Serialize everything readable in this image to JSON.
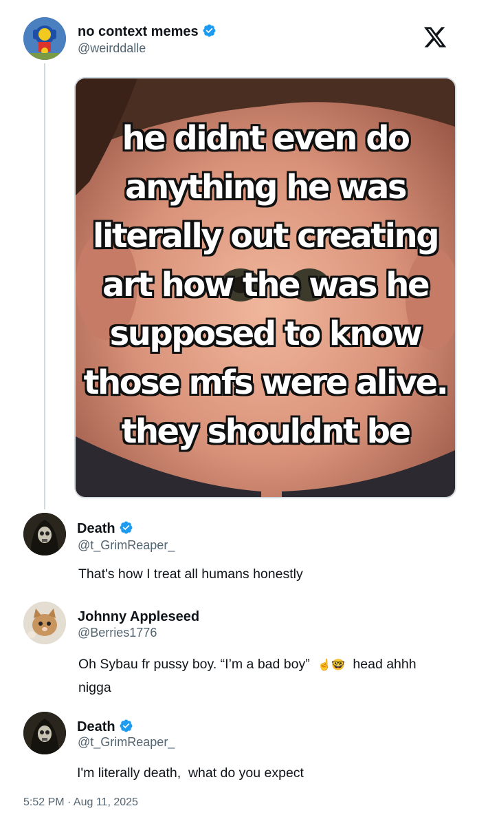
{
  "tweet": {
    "author_name": "no context memes",
    "author_handle": "@weirddalle",
    "meme_lines": [
      "he didnt even do",
      "anything he was",
      "literally out creating",
      "art how the was he",
      "supposed to know",
      "those mfs were alive.",
      "they shouldnt be"
    ],
    "timestamp": "5:52 PM · Aug 11, 2025"
  },
  "replies": [
    {
      "name": "Death",
      "handle": "@t_GrimReaper_",
      "text": "That's how I treat all humans honestly"
    },
    {
      "name": "Johnny Appleseed",
      "handle": "@Berries1776",
      "text_before_emoji": "Oh Sybau fr pussy boy. “I’m a bad boy”",
      "emoji": "☝️🤓",
      "text_line1_end": "head ahhh",
      "text_line2": "nigga"
    },
    {
      "name": "Death",
      "handle": "@t_GrimReaper_",
      "text": "I'm literally death,  what do you expect"
    }
  ],
  "icons": {
    "logo": "x-logo-icon",
    "verified": "verified-badge-icon"
  },
  "colors": {
    "verified_blue": "#1d9bf0",
    "handle_gray": "#536471",
    "border": "#cfd9de"
  }
}
